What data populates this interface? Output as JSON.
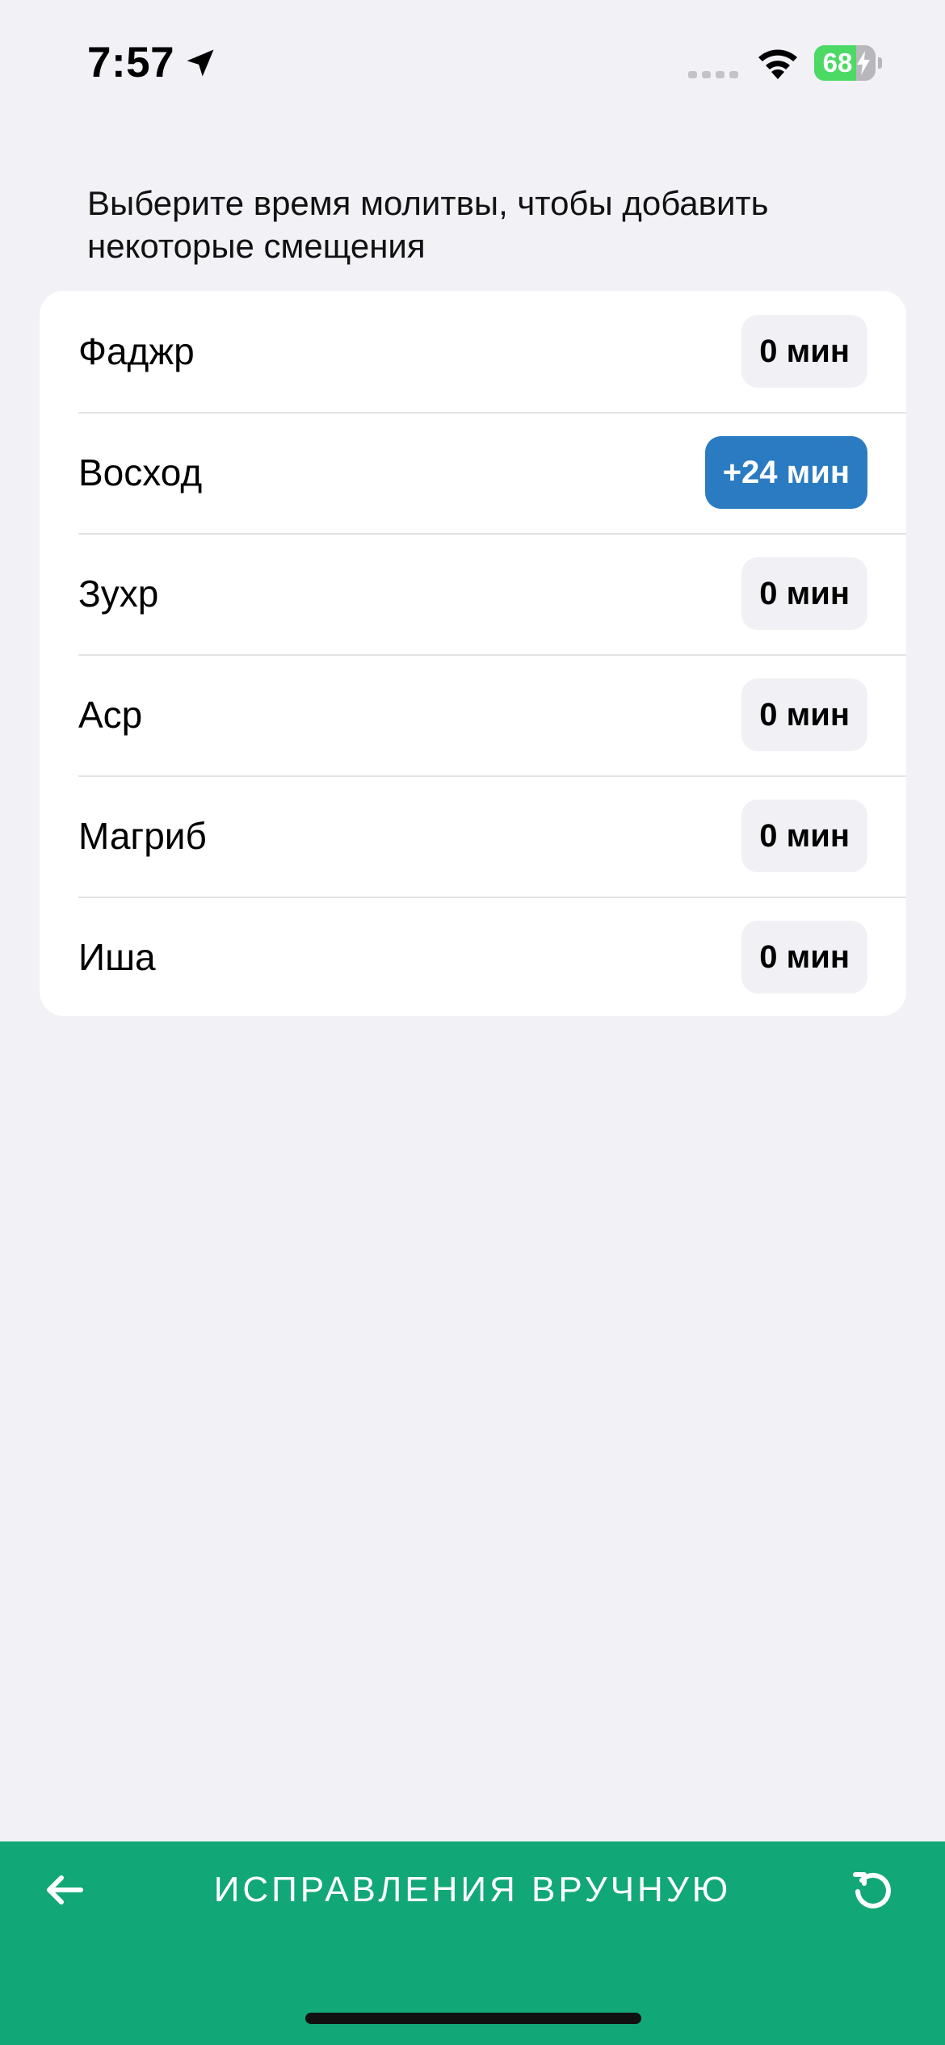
{
  "status_bar": {
    "time": "7:57",
    "battery_level": "68",
    "battery_fraction": 0.68,
    "icons": [
      "location-arrow-icon",
      "signal-dots-icon",
      "wifi-icon",
      "battery-icon",
      "charging-bolt-icon"
    ]
  },
  "instruction": "Выберите время молитвы, чтобы добавить некоторые смещения",
  "prayers": [
    {
      "name": "Фаджр",
      "offset": "0 мин",
      "active": false
    },
    {
      "name": "Восход",
      "offset": "+24 мин",
      "active": true
    },
    {
      "name": "Зухр",
      "offset": "0 мин",
      "active": false
    },
    {
      "name": "Аср",
      "offset": "0 мин",
      "active": false
    },
    {
      "name": "Магриб",
      "offset": "0 мин",
      "active": false
    },
    {
      "name": "Иша",
      "offset": "0 мин",
      "active": false
    }
  ],
  "bottom_bar": {
    "title": "ИСПРАВЛЕНИЯ ВРУЧНУЮ",
    "left_icon": "arrow-left-icon",
    "right_icon": "reset-icon"
  },
  "colors": {
    "accent_green": "#12a776",
    "active_blue": "#2a7bc2",
    "background": "#f1f1f6",
    "battery_green": "#4cd964"
  }
}
